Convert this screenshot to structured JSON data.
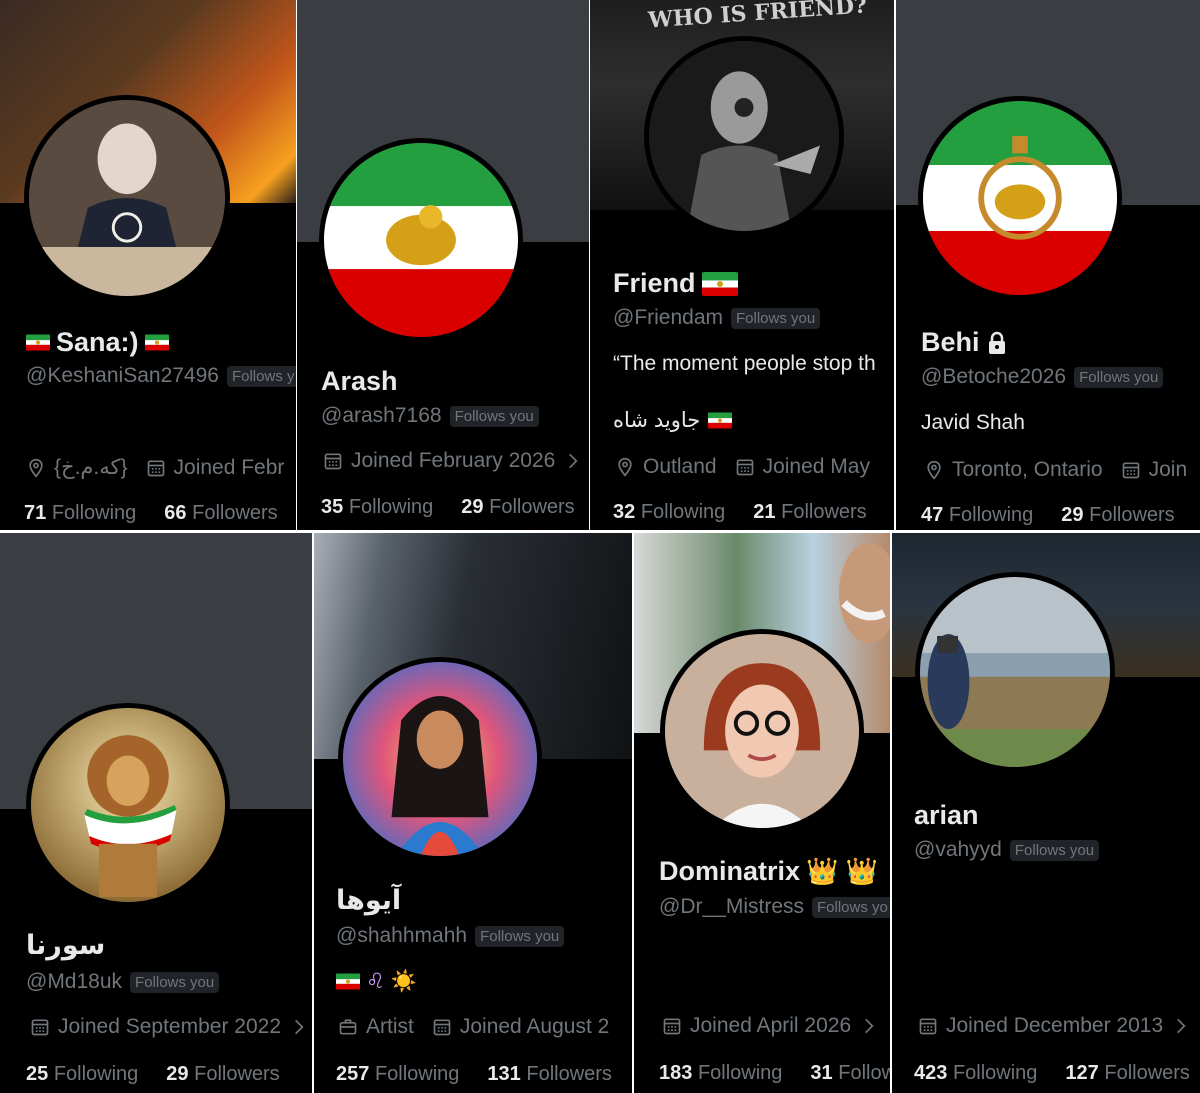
{
  "cards": {
    "c1": {
      "name": "Sana:)",
      "handle": "@KeshaniSan27496",
      "follows_badge": "Follows y",
      "location": "{که.م.خ}",
      "joined": "Joined Febr",
      "following_count": "71",
      "following_label": "Following",
      "followers_count": "66",
      "followers_label": "Followers"
    },
    "c2": {
      "name": "Arash",
      "handle": "@arash7168",
      "follows_badge": "Follows you",
      "joined": "Joined February 2026",
      "following_count": "35",
      "following_label": "Following",
      "followers_count": "29",
      "followers_label": "Followers"
    },
    "c3": {
      "name": "Friend",
      "handle": "@Friendam",
      "follows_badge": "Follows you",
      "bio_quote": "“The moment people stop th",
      "bio_persian": "جاوید شاه",
      "location": "Outland",
      "joined": "Joined May",
      "following_count": "32",
      "following_label": "Following",
      "followers_count": "21",
      "followers_label": "Followers",
      "banner_text": "WHO IS FRIEND?"
    },
    "c4": {
      "name": "Behi",
      "handle": "@Betoche2026",
      "follows_badge": "Follows you",
      "bio": "Javid Shah",
      "location": "Toronto, Ontario",
      "joined": "Join",
      "following_count": "47",
      "following_label": "Following",
      "followers_count": "29",
      "followers_label": "Followers"
    },
    "c5": {
      "name": "سورنا",
      "handle": "@Md18uk",
      "follows_badge": "Follows you",
      "joined": "Joined September 2022",
      "following_count": "25",
      "following_label": "Following",
      "followers_count": "29",
      "followers_label": "Followers"
    },
    "c6": {
      "name": "آیوها",
      "handle": "@shahhmahh",
      "follows_badge": "Follows you",
      "bio_emoji": "♌ ☀️",
      "profession": "Artist",
      "joined": "Joined August 2",
      "following_count": "257",
      "following_label": "Following",
      "followers_count": "131",
      "followers_label": "Followers"
    },
    "c7": {
      "name": "Dominatrix",
      "name_emoji": "👑 👑",
      "handle": "@Dr__Mistress",
      "follows_badge": "Follows yo",
      "joined": "Joined April 2026",
      "following_count": "183",
      "following_label": "Following",
      "followers_count": "31",
      "followers_label": "Follow"
    },
    "c8": {
      "name": "arian",
      "handle": "@vahyyd",
      "follows_badge": "Follows you",
      "joined": "Joined December 2013",
      "following_count": "423",
      "following_label": "Following",
      "followers_count": "127",
      "followers_label": "Followers"
    }
  },
  "colors": {
    "background": "#000000",
    "banner_gray": "#3a3d41",
    "text_primary": "#e7e9ea",
    "text_secondary": "#71767b",
    "badge_bg": "#202327",
    "flag_green": "#239f40",
    "flag_white": "#ffffff",
    "flag_red": "#da0000",
    "lion_gold": "#d4a017"
  },
  "icons": {
    "location": "location-pin-icon",
    "calendar": "calendar-icon",
    "chevron": "chevron-right-icon",
    "briefcase": "briefcase-icon",
    "lock": "lock-icon",
    "crown": "crown-icon",
    "leo": "leo-zodiac-icon",
    "sun": "sun-icon",
    "flag": "iran-lion-sun-flag-icon"
  }
}
